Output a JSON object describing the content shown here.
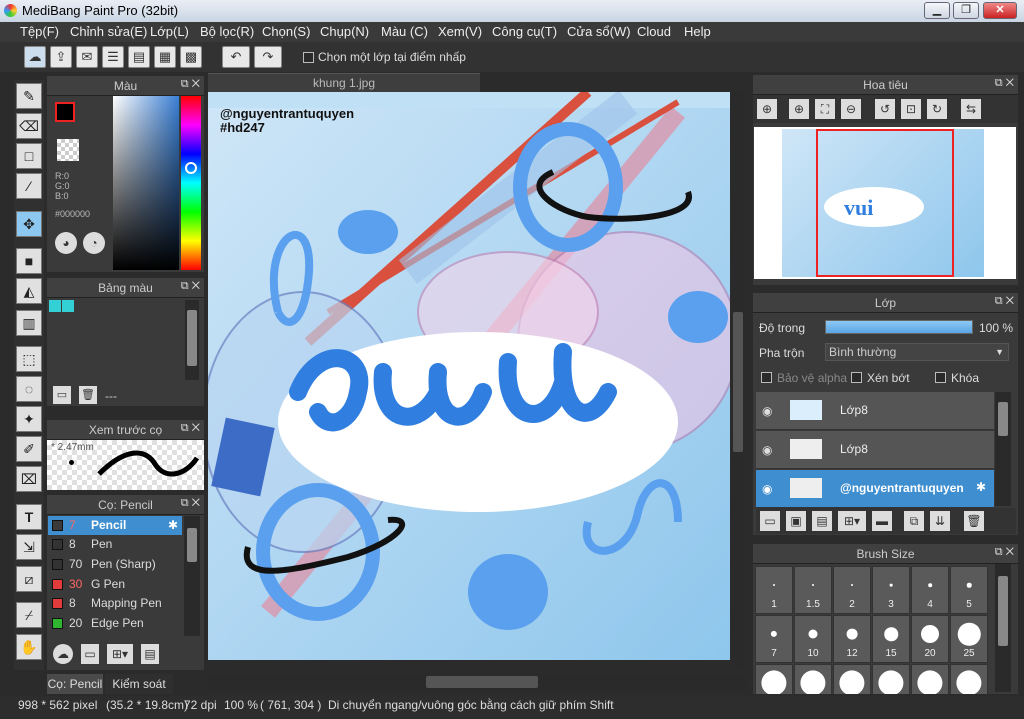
{
  "window": {
    "title": "MediBang Paint Pro (32bit)",
    "min": "▁",
    "max": "❐",
    "close": "✕"
  },
  "menu": [
    "Tệp(F)",
    "Chỉnh sửa(E)",
    "Lớp(L)",
    "Bộ lọc(R)",
    "Chọn(S)",
    "Chụp(N)",
    "Màu (C)",
    "Xem(V)",
    "Công cụ(T)",
    "Cửa sổ(W)",
    "Cloud",
    "Help"
  ],
  "toolbar": {
    "select_layer_label": "Chọn một lớp tại điểm nhấp"
  },
  "color_panel": {
    "title": "Màu",
    "r": "R:0",
    "g": "G:0",
    "b": "B:0",
    "hex": "#000000",
    "main_color": "#000000"
  },
  "palette_panel": {
    "title": "Bảng màu",
    "swatches": [
      "#33d0d6",
      "#33d0d6"
    ],
    "footer_text": "---"
  },
  "preview_panel": {
    "title": "Xem trước cọ",
    "size": "* 2.47mm"
  },
  "brush_panel": {
    "title": "Cọ: Pencil",
    "items": [
      {
        "size": "7",
        "name": "Pencil",
        "color": "#3a3a3a",
        "selected": true
      },
      {
        "size": "8",
        "name": "Pen",
        "color": "#333333"
      },
      {
        "size": "70",
        "name": "Pen (Sharp)",
        "color": "#333333"
      },
      {
        "size": "30",
        "name": "G Pen",
        "color": "#e23b3b"
      },
      {
        "size": "8",
        "name": "Mapping Pen",
        "color": "#e23b3b"
      },
      {
        "size": "20",
        "name": "Edge Pen",
        "color": "#2fb52f"
      }
    ]
  },
  "bottom_tabs": [
    "Cọ: Pencil",
    "Kiểm soát cọ"
  ],
  "document_tab": "khung 1.jpg",
  "canvas": {
    "watermark1": "@nguyentrantuquyen",
    "watermark2": "#hd247",
    "word": "vui"
  },
  "navigator": {
    "title": "Hoa tiêu"
  },
  "layer_panel": {
    "title": "Lớp",
    "opacity_label": "Độ trong",
    "opacity_value": "100 %",
    "opacity": 1.0,
    "blend_label": "Pha trộn",
    "blend_value": "Bình thường",
    "protect_alpha": "Bảo vệ alpha",
    "clip": "Xén bớt",
    "lock": "Khóa",
    "layers": [
      "Lớp8",
      "Lớp8",
      "@nguyentrantuquyen"
    ]
  },
  "brush_size_panel": {
    "title": "Brush Size",
    "sizes": [
      "1",
      "1.5",
      "2",
      "3",
      "4",
      "5",
      "7",
      "10",
      "12",
      "15",
      "20",
      "25",
      "",
      "",
      "",
      "",
      "",
      ""
    ]
  },
  "status": {
    "dimensions": "998 * 562 pixel",
    "physical": "(35.2 * 19.8cm)",
    "dpi": "72 dpi",
    "zoom": "100 %",
    "coords": "( 761, 304 )",
    "hint": "Di chuyển ngang/vuông góc bằng cách giữ phím Shift"
  }
}
